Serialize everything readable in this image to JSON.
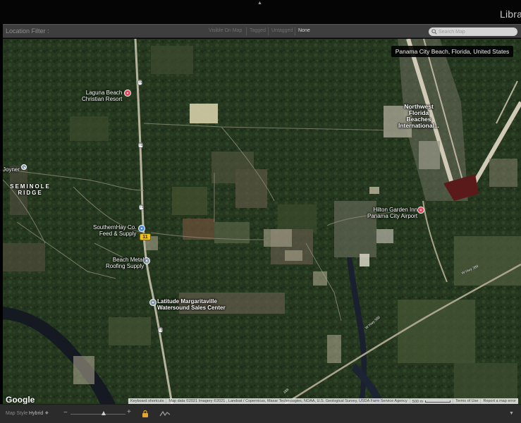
{
  "topbar": {
    "arrow": "▲",
    "module_label": "Librar"
  },
  "filter": {
    "label": "Location Filter :",
    "options": [
      "Visible On Map",
      "Tagged",
      "Untagged",
      "None"
    ],
    "active": "None",
    "search_placeholder": "Search Map"
  },
  "map": {
    "location_tooltip": "Panama City Beach, Florida, United States",
    "pois": {
      "laguna_line1": "Laguna Beach",
      "laguna_line2": "Christian Resort",
      "northwest_line1": "Northwest",
      "northwest_line2": "Florida",
      "northwest_line3": "Beaches",
      "northwest_line4": "International...",
      "hilton_line1": "Hilton Garden Inn",
      "hilton_line2": "Panama City Airport",
      "southern_line1": "SouthernHay Co.",
      "southern_line2": "Feed & Supply",
      "beachmetal_line1": "Beach Metal",
      "beachmetal_line2": "Roofing Supply",
      "latitude_line1": "Latitude Margaritaville",
      "latitude_line2": "Watersound Sales Center",
      "joyner": "Joyner",
      "seminole_line1": "SEMINOLE",
      "seminole_line2": "RIDGE"
    },
    "road_labels": {
      "r79a": "79",
      "r79b": "79",
      "r79c": "79",
      "r79d": "79",
      "highway_shield": "11",
      "whwy388_a": "W Hwy 388",
      "whwy388_b": "W Hwy 388",
      "r388": "388"
    },
    "google_logo": "Google",
    "attribution": {
      "shortcuts": "Keyboard shortcuts",
      "data": "Map data ©2021 Imagery ©2021 , Landsat / Copernicus, Maxar Technologies, NOAA, U.S. Geological Survey, USDA Farm Service Agency",
      "scale": "500 m",
      "terms": "Terms of Use",
      "report": "Report a map error"
    }
  },
  "bottombar": {
    "map_style_label": "Map Style :",
    "map_style_value": "Hybrid",
    "caret": "◆",
    "zoom_minus": "−",
    "zoom_plus": "+",
    "expand": "▼"
  },
  "colors": {
    "forest": "#24371f",
    "runway": "#c8c2b0",
    "river": "#1a1f2a",
    "pin_red": "#e5485b",
    "highway_yellow": "#f0c419"
  }
}
